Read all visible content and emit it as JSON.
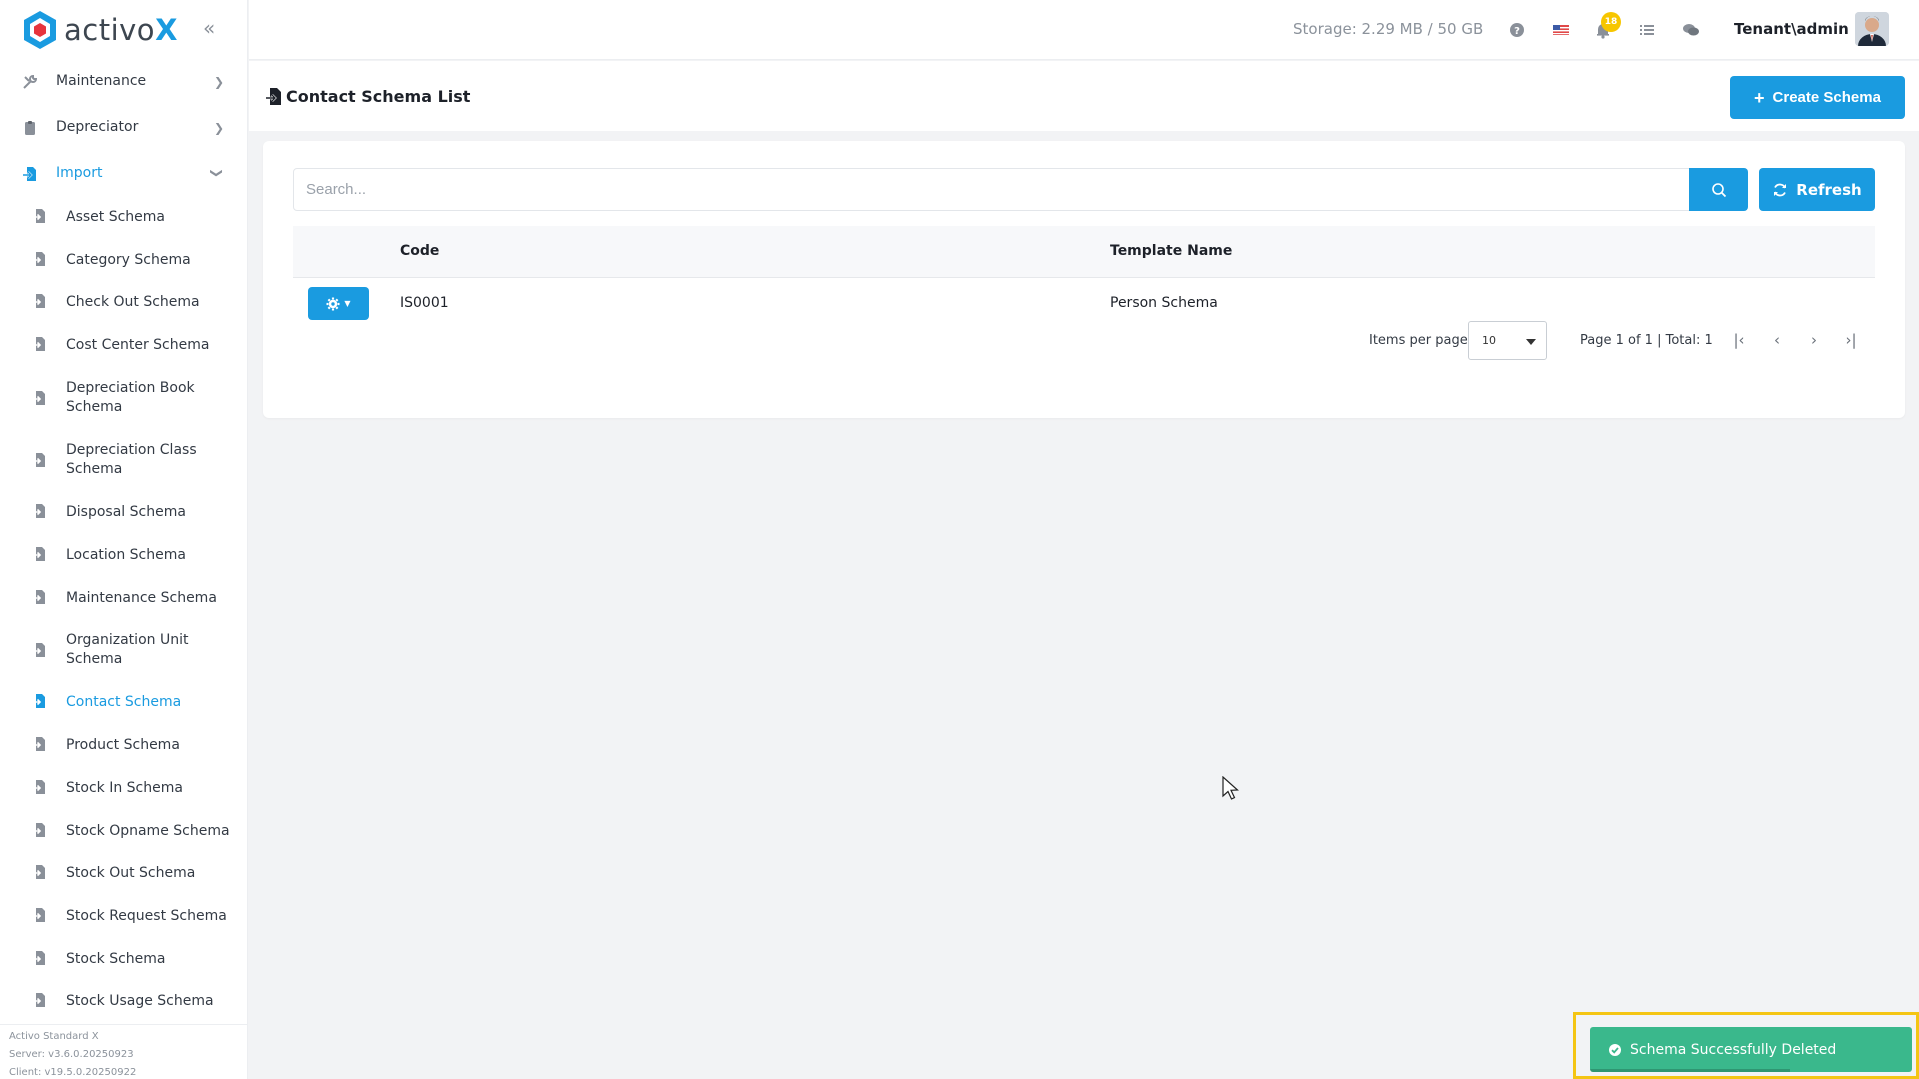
{
  "brand": {
    "name_prefix": "activo",
    "name_suffix": "X"
  },
  "sidebar": {
    "top_items": [
      {
        "label": "Maintenance",
        "state": "collapsed"
      },
      {
        "label": "Depreciator",
        "state": "collapsed"
      },
      {
        "label": "Import",
        "state": "expanded"
      }
    ],
    "import_items": [
      {
        "label": "Asset Schema"
      },
      {
        "label": "Category Schema"
      },
      {
        "label": "Check Out Schema"
      },
      {
        "label": "Cost Center Schema"
      },
      {
        "label": "Depreciation Book Schema"
      },
      {
        "label": "Depreciation Class Schema"
      },
      {
        "label": "Disposal Schema"
      },
      {
        "label": "Location Schema"
      },
      {
        "label": "Maintenance Schema"
      },
      {
        "label": "Organization Unit Schema"
      },
      {
        "label": "Contact Schema"
      },
      {
        "label": "Product Schema"
      },
      {
        "label": "Stock In Schema"
      },
      {
        "label": "Stock Opname Schema"
      },
      {
        "label": "Stock Out Schema"
      },
      {
        "label": "Stock Request Schema"
      },
      {
        "label": "Stock Schema"
      },
      {
        "label": "Stock Usage Schema"
      }
    ],
    "active_item": "Contact Schema",
    "version": {
      "product": "Activo Standard X",
      "server": "Server: v3.6.0.20250923",
      "client": "Client: v19.5.0.20250922"
    }
  },
  "header": {
    "storage": "Storage: 2.29 MB / 50 GB",
    "notifications_count": "18",
    "user": "Tenant\\admin",
    "icons": [
      "help-icon",
      "us-flag-icon",
      "bell-icon",
      "task-list-icon",
      "chat-icon"
    ]
  },
  "page": {
    "title": "Contact Schema List",
    "create_button": "Create Schema"
  },
  "search": {
    "placeholder": "Search...",
    "value": ""
  },
  "refresh_label": "Refresh",
  "table": {
    "columns": [
      "Code",
      "Template Name"
    ],
    "rows": [
      {
        "code": "IS0001",
        "template_name": "Person Schema"
      }
    ]
  },
  "pagination": {
    "items_per_page_label": "Items per page",
    "items_per_page": "10",
    "info": "Page 1 of 1 | Total: 1"
  },
  "toast": {
    "message": "Schema Successfully Deleted"
  },
  "colors": {
    "primary": "#1a9be0",
    "success": "#3ab88c",
    "badge": "#f7c600",
    "highlight": "#f4c514"
  }
}
